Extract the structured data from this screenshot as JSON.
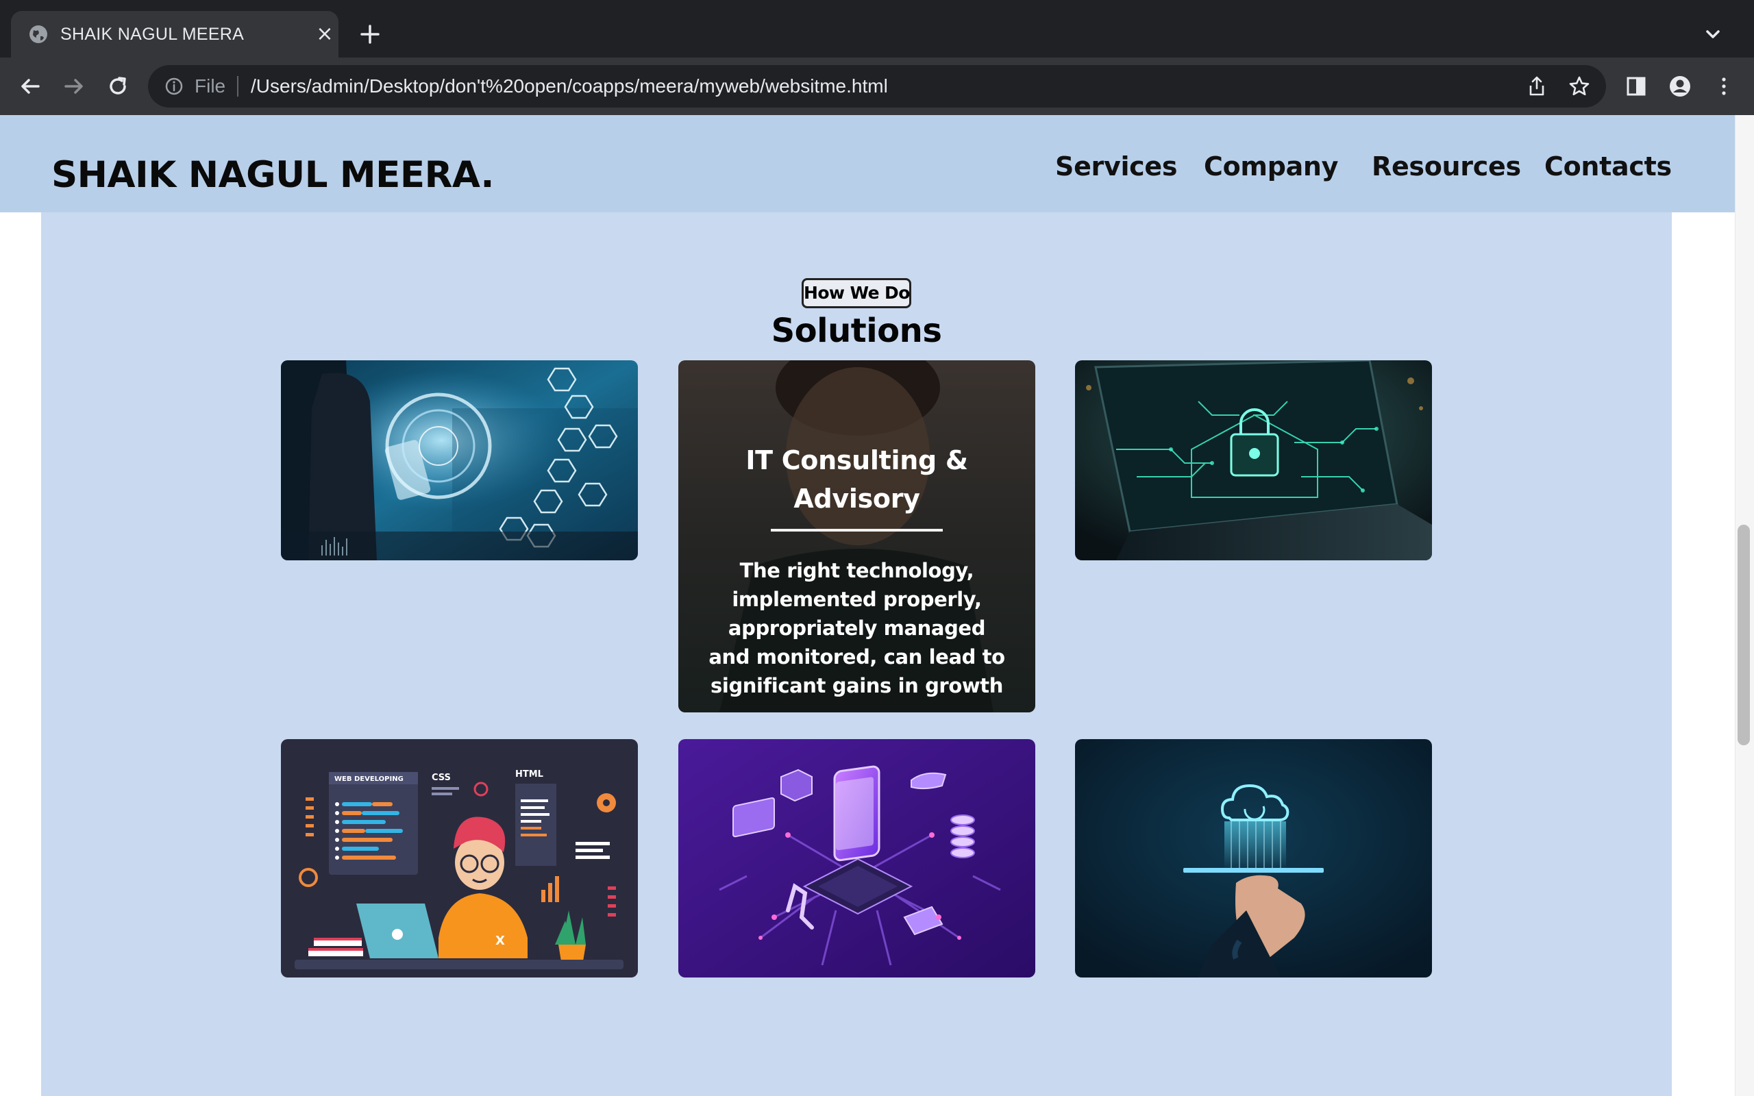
{
  "browser": {
    "tab_title": "SHAIK NAGUL MEERA",
    "omnibox_scheme": "File",
    "url": "/Users/admin/Desktop/don't%20open/coapps/meera/myweb/websitme.html"
  },
  "site": {
    "brand": "SHAIK NAGUL MEERA.",
    "nav": [
      "Services",
      "Company",
      "Resources",
      "Contacts"
    ]
  },
  "section": {
    "badge": "How We Do",
    "title": "Solutions"
  },
  "cards": [
    {
      "image": "digital-business-technology"
    },
    {
      "image": "consultant-portrait",
      "title": "IT Consulting & Advisory",
      "text": "The right technology, implemented properly, appropriately managed and monitored, can lead to significant gains in growth"
    },
    {
      "image": "laptop-security-lock"
    },
    {
      "image": "web-developer-illustration",
      "labels": [
        "WEB DEVELOPING",
        "CSS",
        "HTML"
      ]
    },
    {
      "image": "isometric-iot-chip"
    },
    {
      "image": "cloud-computing-hand"
    }
  ],
  "colors": {
    "header_bg": "#b8cfea",
    "section_bg": "#c9d9f0",
    "chrome_dark": "#202124",
    "chrome_toolbar": "#35363a"
  }
}
